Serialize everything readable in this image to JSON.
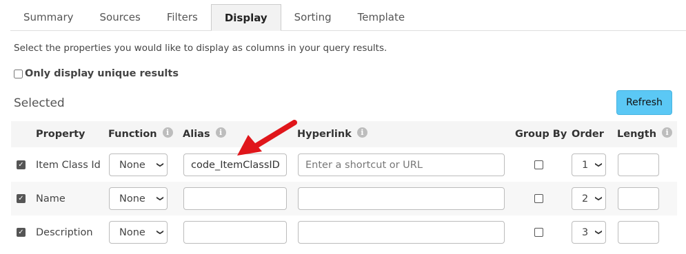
{
  "tabs": [
    "Summary",
    "Sources",
    "Filters",
    "Display",
    "Sorting",
    "Template"
  ],
  "active_tab": "Display",
  "description": "Select the properties you would like to display as columns in your query results.",
  "unique_label": "Only display unique results",
  "selected_title": "Selected",
  "refresh_label": "Refresh",
  "columns": {
    "property": "Property",
    "function": "Function",
    "alias": "Alias",
    "hyperlink": "Hyperlink",
    "group_by": "Group By",
    "order": "Order",
    "length": "Length"
  },
  "rows": [
    {
      "property": "Item Class Id",
      "function": "None",
      "alias": "code_ItemClassID",
      "hyperlink": "",
      "order": "1"
    },
    {
      "property": "Name",
      "function": "None",
      "alias": "",
      "hyperlink": "",
      "order": "2"
    },
    {
      "property": "Description",
      "function": "None",
      "alias": "",
      "hyperlink": "",
      "order": "3"
    }
  ],
  "hyperlink_placeholder": "Enter a shortcut or URL",
  "colors": {
    "accent": "#5bc8f5",
    "arrow": "#e0161b"
  },
  "icons": {
    "info": "info-icon",
    "chevron": "chevron-down-icon",
    "check": "checkmark-icon"
  }
}
